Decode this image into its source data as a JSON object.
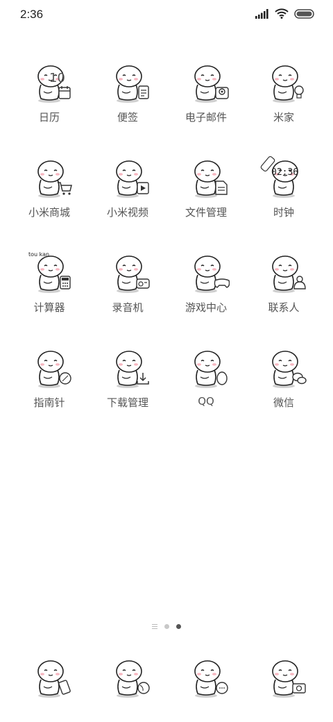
{
  "status": {
    "time": "2:36"
  },
  "apps": [
    {
      "id": "calendar",
      "label": "日历",
      "prop": "calendar",
      "calendar_day": "10"
    },
    {
      "id": "notes",
      "label": "便签",
      "prop": "notes"
    },
    {
      "id": "email",
      "label": "电子邮件",
      "prop": "email"
    },
    {
      "id": "mijia",
      "label": "米家",
      "prop": "bulb"
    },
    {
      "id": "mi-store",
      "label": "小米商城",
      "prop": "cart"
    },
    {
      "id": "mi-video",
      "label": "小米视频",
      "prop": "video"
    },
    {
      "id": "file-manager",
      "label": "文件管理",
      "prop": "file"
    },
    {
      "id": "clock",
      "label": "时钟",
      "prop": "clock",
      "clock_time": "02:36"
    },
    {
      "id": "calculator",
      "label": "计算器",
      "prop": "calculator",
      "caption": "tou kan"
    },
    {
      "id": "recorder",
      "label": "录音机",
      "prop": "radio"
    },
    {
      "id": "game-center",
      "label": "游戏中心",
      "prop": "gamepad"
    },
    {
      "id": "contacts",
      "label": "联系人",
      "prop": "person"
    },
    {
      "id": "compass",
      "label": "指南针",
      "prop": "compass"
    },
    {
      "id": "downloads",
      "label": "下载管理",
      "prop": "download"
    },
    {
      "id": "qq",
      "label": "QQ",
      "prop": "penguin"
    },
    {
      "id": "wechat",
      "label": "微信",
      "prop": "wechat"
    }
  ],
  "dock": [
    {
      "id": "phone",
      "prop": "phone"
    },
    {
      "id": "browser",
      "prop": "globe"
    },
    {
      "id": "messages",
      "prop": "bubble"
    },
    {
      "id": "camera",
      "prop": "camera"
    }
  ],
  "pages": {
    "count": 2,
    "current": 2
  }
}
